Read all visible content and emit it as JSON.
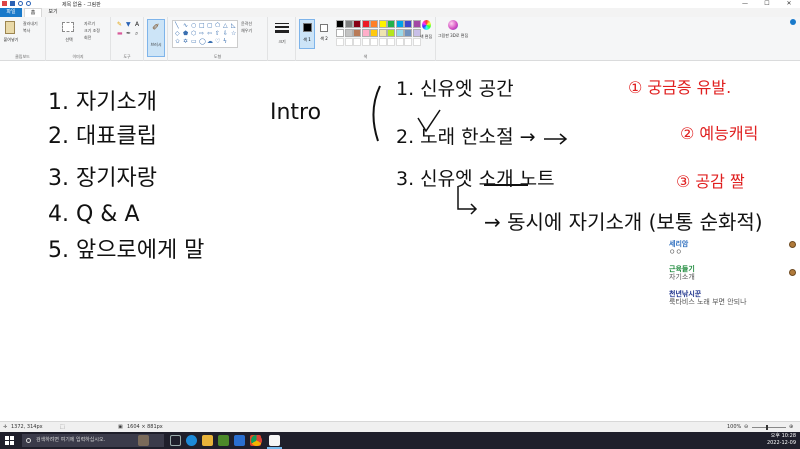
{
  "window": {
    "title": "제목 없음 - 그림판",
    "controls": [
      "—",
      "☐",
      "✕"
    ]
  },
  "tabs": {
    "file": "파일",
    "home": "홈",
    "view": "보기"
  },
  "ribbon": {
    "clipboard": {
      "paste": "붙여넣기",
      "cut": "잘라내기",
      "copy": "복사",
      "label": "클립보드"
    },
    "image": {
      "select": "선택",
      "crop": "자르기",
      "resize": "크기 조정",
      "rotate": "회전",
      "label": "이미지"
    },
    "tools": {
      "label": "도구"
    },
    "brushes": {
      "label": "브러시"
    },
    "shapes": {
      "outline": "윤곽선",
      "fill": "채우기",
      "label": "도형"
    },
    "size": {
      "label": "크기"
    },
    "color1": "색 1",
    "color2": "색 2",
    "edit_colors": "색 편집",
    "paint3d": "그림판 3D로 편집",
    "colors_label": "색",
    "palette": [
      "#000000",
      "#7f7f7f",
      "#880015",
      "#ed1c24",
      "#ff7f27",
      "#fff200",
      "#22b14c",
      "#00a2e8",
      "#3f48cc",
      "#a349a4",
      "#ffffff",
      "#c3c3c3",
      "#b97a57",
      "#ffaec9",
      "#ffc90e",
      "#efe4b0",
      "#b5e61d",
      "#99d9ea",
      "#7092be",
      "#c8bfe7"
    ]
  },
  "canvas": {
    "agenda": [
      "1. 자기소개",
      "2. 대표클립",
      "3. 장기자랑",
      "4. Q & A",
      "5. 앞으로에게 말"
    ],
    "intro_word": "Intro",
    "intro_items": [
      "1. 신유엣 공간",
      "2. 노래 한소절 →",
      "3. 신유엣 소개 노트"
    ],
    "intro_arrow_line": "→ 동시에 자기소개 (보통 순화적)",
    "red_notes": [
      "① 궁금증 유발.",
      "② 예능캐릭",
      "③ 공감 짤"
    ],
    "note_color": "#e02020",
    "ink_color": "#111111"
  },
  "comments": [
    {
      "name": "세리암",
      "text": "ㅇㅇ",
      "name_color": "#2f6fbf"
    },
    {
      "name": "근육들기",
      "text": "자기소개",
      "name_color": "#1e8a3c"
    },
    {
      "name": "천년낚시꾼",
      "text": "룩타비스 노래 부면 안되나",
      "name_color": "#1a2f8a"
    }
  ],
  "statusbar": {
    "cursor": "1372, 314px",
    "selection": "",
    "canvas_size": "1604 × 881px",
    "zoom": "100%"
  },
  "taskbar": {
    "search_placeholder": "검색하려면 여기에 입력하십시오.",
    "time": "오후 10:28",
    "date": "2022-12-09"
  }
}
